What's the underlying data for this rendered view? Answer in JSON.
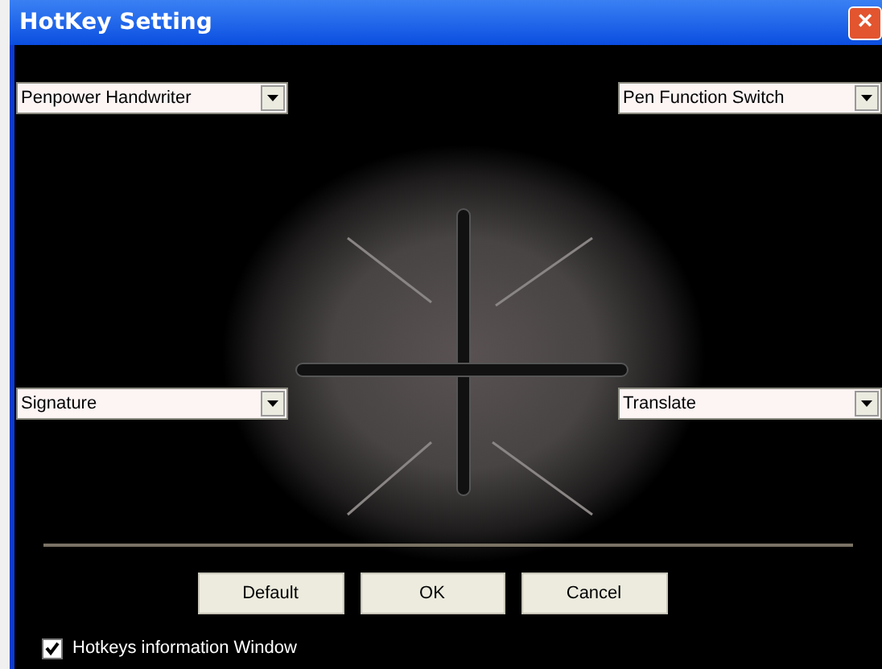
{
  "window": {
    "title": "HotKey Setting",
    "close_icon": "×"
  },
  "dropdowns": [
    {
      "value": "Penpower Handwriter"
    },
    {
      "value": "Pen Function Switch"
    },
    {
      "value": "Signature"
    },
    {
      "value": "Translate"
    }
  ],
  "buttons": [
    "Default",
    "OK",
    "Cancel"
  ],
  "checkbox": {
    "label": "Hotkeys information Window",
    "checked": true
  }
}
